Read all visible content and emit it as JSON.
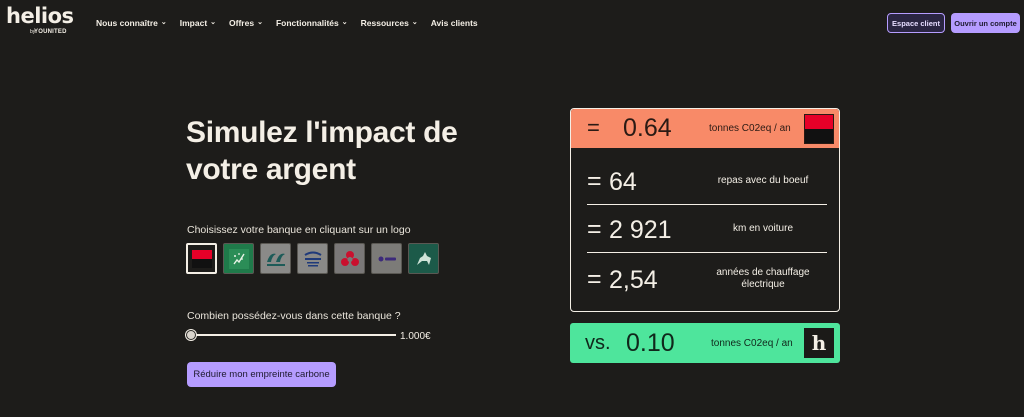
{
  "brand": {
    "name": "helios",
    "by": "by",
    "partner": "YOUNITED"
  },
  "nav": {
    "items": [
      {
        "label": "Nous connaître",
        "dropdown": true
      },
      {
        "label": "Impact",
        "dropdown": true
      },
      {
        "label": "Offres",
        "dropdown": true
      },
      {
        "label": "Fonctionnalités",
        "dropdown": true
      },
      {
        "label": "Ressources",
        "dropdown": true
      },
      {
        "label": "Avis clients",
        "dropdown": false
      }
    ],
    "chevron": "⌄"
  },
  "header": {
    "espace_client": "Espace client",
    "ouvrir_compte": "Ouvrir un compte"
  },
  "hero": {
    "title_bold": "Simulez l'impact",
    "title_rest": " de votre argent",
    "choose_label": "Choisissez votre banque en cliquant sur un logo",
    "banks": [
      {
        "id": "societe-generale",
        "icon": "societe-generale-logo",
        "selected": true
      },
      {
        "id": "bnp-paribas",
        "icon": "bnp-paribas-logo",
        "selected": false
      },
      {
        "id": "credit-agricole",
        "icon": "credit-agricole-logo",
        "selected": false
      },
      {
        "id": "la-banque-postale",
        "icon": "la-banque-postale-logo",
        "selected": false
      },
      {
        "id": "caisse-epargne",
        "icon": "caisse-epargne-logo",
        "selected": false
      },
      {
        "id": "bpce",
        "icon": "bpce-logo",
        "selected": false
      },
      {
        "id": "lcl",
        "icon": "lcl-logo",
        "selected": false
      }
    ],
    "amount_label": "Combien possédez-vous dans cette banque ?",
    "amount_value": "1.000€",
    "slider_fraction": 0.0,
    "cta": "Réduire mon empreinte carbone"
  },
  "impact": {
    "eq": "=",
    "value": "0.64",
    "unit": "tonnes C02eq / an",
    "accent": "#f88a68",
    "equivalences": [
      {
        "value": "64",
        "label": "repas avec du boeuf"
      },
      {
        "value": "2 921",
        "label": "km en voiture"
      },
      {
        "value": "2,54",
        "label": "années de chauffage électrique"
      }
    ]
  },
  "helios_compare": {
    "vs": "vs.",
    "value": "0.10",
    "unit": "tonnes C02eq / an",
    "logo_letter": "h",
    "accent": "#4ee59c"
  },
  "colors": {
    "background": "#1d1c1a",
    "lavender": "#b59cff",
    "societe_generale_red": "#e60028"
  }
}
